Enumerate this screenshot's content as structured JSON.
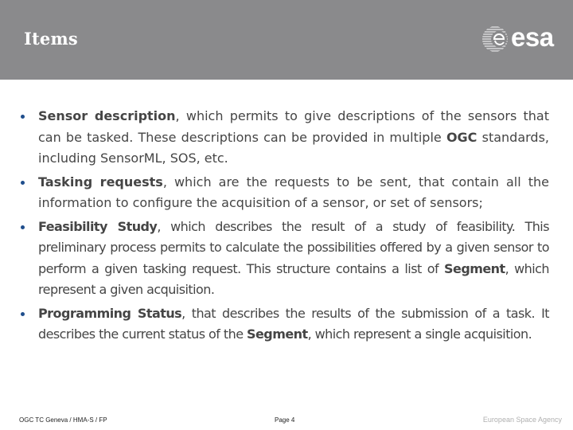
{
  "header": {
    "title": "Items",
    "logo_text": "esa",
    "logo_icon": "esa-globe-icon"
  },
  "items": [
    {
      "term": "Sensor description",
      "text": ", which permits to give descriptions of the sensors that can be tasked. These descriptions can be provided in multiple ",
      "term2": "OGC",
      "text2": " standards, including SensorML, SOS, etc."
    },
    {
      "term": "Tasking requests",
      "text": ", which are the requests to be sent, that contain all the information to configure the acquisition of a sensor, or set of sensors;"
    },
    {
      "term": "Feasibility Study",
      "text": ", which describes the result of a study of feasibility. This preliminary process permits to calculate the possibilities offered by a given sensor to perform a given tasking request. This structure contains a list of ",
      "term2": "Segment",
      "text2": ", which represent a given acquisition."
    },
    {
      "term": "Programming Status",
      "text": ", that describes the results of the submission of a task. It describes the current status of the ",
      "term2": "Segment",
      "text2": ", which represent a single acquisition."
    }
  ],
  "footer": {
    "left": "OGC TC Geneva / HMA-S / FP",
    "center": "Page 4",
    "right": "European Space Agency"
  },
  "colors": {
    "header_bg": "#8a8a8c",
    "bullet": "#1f4e8c",
    "text": "#454545"
  }
}
